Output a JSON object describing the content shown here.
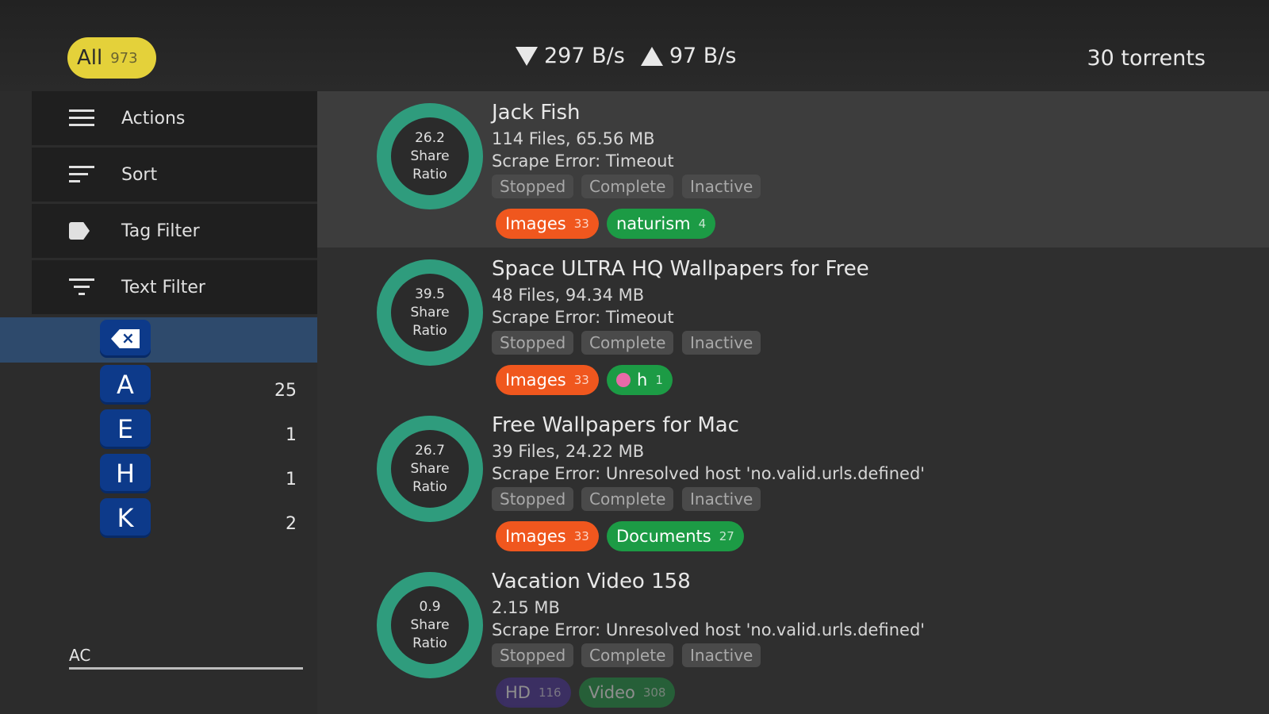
{
  "header": {
    "all_label": "All",
    "all_count": "973",
    "download_speed": "297 B/s",
    "upload_speed": "97 B/s",
    "torrent_count": "30 torrents"
  },
  "sidebar": {
    "menu": [
      {
        "label": "Actions",
        "icon": "menu-icon"
      },
      {
        "label": "Sort",
        "icon": "sort-icon"
      },
      {
        "label": "Tag Filter",
        "icon": "tag-icon"
      },
      {
        "label": "Text Filter",
        "icon": "filter-icon"
      }
    ],
    "keys": [
      {
        "letter": "A",
        "count": "25"
      },
      {
        "letter": "E",
        "count": "1"
      },
      {
        "letter": "H",
        "count": "1"
      },
      {
        "letter": "K",
        "count": "2"
      }
    ],
    "filter_value": "AC"
  },
  "torrents": [
    {
      "ratio": "26.2",
      "ratio_label1": "Share",
      "ratio_label2": "Ratio",
      "name": "Jack Fish",
      "info": "114 Files, 65.56 MB",
      "error": "Scrape Error: Timeout",
      "states": [
        "Stopped",
        "Complete",
        "Inactive"
      ],
      "tags": [
        {
          "name": "Images",
          "count": "33"
        },
        {
          "name": "naturism",
          "count": "4"
        }
      ]
    },
    {
      "ratio": "39.5",
      "ratio_label1": "Share",
      "ratio_label2": "Ratio",
      "name": "Space ULTRA HQ Wallpapers for Free",
      "info": "48 Files, 94.34 MB",
      "error": "Scrape Error: Timeout",
      "states": [
        "Stopped",
        "Complete",
        "Inactive"
      ],
      "tags": [
        {
          "name": "Images",
          "count": "33"
        },
        {
          "name": "h",
          "count": "1"
        }
      ]
    },
    {
      "ratio": "26.7",
      "ratio_label1": "Share",
      "ratio_label2": "Ratio",
      "name": "Free Wallpapers for Mac",
      "info": "39 Files, 24.22 MB",
      "error": "Scrape Error: Unresolved host 'no.valid.urls.defined'",
      "states": [
        "Stopped",
        "Complete",
        "Inactive"
      ],
      "tags": [
        {
          "name": "Images",
          "count": "33"
        },
        {
          "name": "Documents",
          "count": "27"
        }
      ]
    },
    {
      "ratio": "0.9",
      "ratio_label1": "Share",
      "ratio_label2": "Ratio",
      "name": "Vacation Video 158",
      "info": "2.15 MB",
      "error": "Scrape Error: Unresolved host 'no.valid.urls.defined'",
      "states": [
        "Stopped",
        "Complete",
        "Inactive"
      ],
      "tags": [
        {
          "name": "HD",
          "count": "116"
        },
        {
          "name": "Video",
          "count": "308"
        }
      ]
    }
  ],
  "colors": {
    "all_pill": "#e4d13a",
    "ratio_ring": "#2f9c7d",
    "tag_images": "#f0571e",
    "tag_green": "#1c9b45",
    "tag_hd": "#4a2fa0",
    "key_blue": "#0d3a8a",
    "selected_row": "#2e4a6c"
  }
}
